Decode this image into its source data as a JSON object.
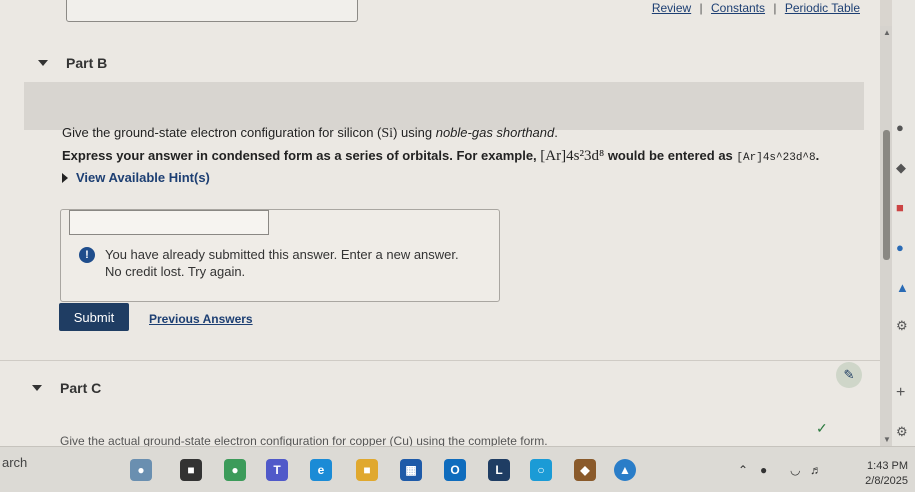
{
  "top_links": {
    "review": "Review",
    "constants": "Constants",
    "periodic_table": "Periodic Table",
    "sep": "|"
  },
  "part_b": {
    "title": "Part B",
    "question_pre": "Give the ground-state electron configuration for silicon (",
    "question_symbol": "Si",
    "question_mid": ") using ",
    "question_italic": "noble-gas shorthand",
    "question_end": ".",
    "instruction_pre": "Express your answer in condensed form as a series of orbitals. For example,",
    "instruction_example": "[Ar]4s²3d⁸",
    "instruction_mid": "would be entered as",
    "instruction_code": "[Ar]4s^23d^8",
    "instruction_end": ".",
    "hint_label": "View Available Hint(s)",
    "answer_value": "",
    "warning_line1": "You have already submitted this answer. Enter a new answer.",
    "warning_line2": "No credit lost. Try again.",
    "warning_glyph": "!",
    "submit_label": "Submit",
    "previous_answers_label": "Previous Answers"
  },
  "part_c": {
    "title": "Part C",
    "question_partial": "Give the actual ground-state electron configuration for copper (Cu) using the complete form."
  },
  "taskbar": {
    "search_text": "arch",
    "time": "1:43 PM",
    "date": "2/8/2025"
  },
  "colors": {
    "accent": "#1f3d63",
    "link": "#1d3f73",
    "warning_icon": "#1f4d8c"
  }
}
